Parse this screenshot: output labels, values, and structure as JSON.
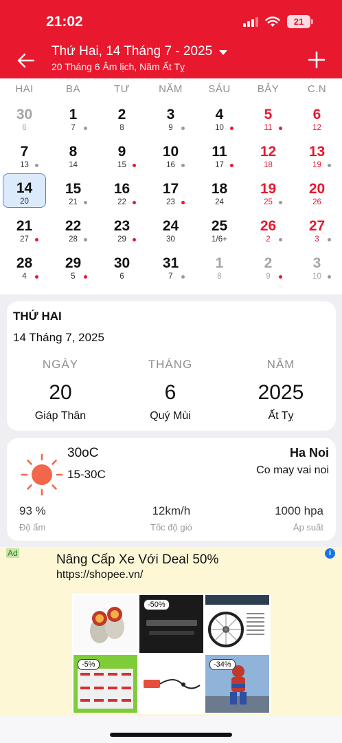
{
  "status_bar": {
    "time": "21:02",
    "battery": "21"
  },
  "header": {
    "title": "Thứ Hai, 14 Tháng 7 - 2025",
    "subtitle": "20 Tháng 6 Âm lịch, Năm Ất Tỵ"
  },
  "weekdays": [
    "HAI",
    "BA",
    "TƯ",
    "NĂM",
    "SÁU",
    "BẢY",
    "C.N"
  ],
  "calendar_days": [
    {
      "solar": "30",
      "lunar": "6",
      "color": "gray",
      "dot": ""
    },
    {
      "solar": "1",
      "lunar": "7",
      "color": "normal",
      "dot": "gray"
    },
    {
      "solar": "2",
      "lunar": "8",
      "color": "normal",
      "dot": ""
    },
    {
      "solar": "3",
      "lunar": "9",
      "color": "normal",
      "dot": "gray"
    },
    {
      "solar": "4",
      "lunar": "10",
      "color": "normal",
      "dot": "red"
    },
    {
      "solar": "5",
      "lunar": "11",
      "color": "red",
      "dot": "red"
    },
    {
      "solar": "6",
      "lunar": "12",
      "color": "red",
      "dot": ""
    },
    {
      "solar": "7",
      "lunar": "13",
      "color": "normal",
      "dot": "gray"
    },
    {
      "solar": "8",
      "lunar": "14",
      "color": "normal",
      "dot": ""
    },
    {
      "solar": "9",
      "lunar": "15",
      "color": "normal",
      "dot": "red"
    },
    {
      "solar": "10",
      "lunar": "16",
      "color": "normal",
      "dot": "gray"
    },
    {
      "solar": "11",
      "lunar": "17",
      "color": "normal",
      "dot": "red"
    },
    {
      "solar": "12",
      "lunar": "18",
      "color": "red",
      "dot": ""
    },
    {
      "solar": "13",
      "lunar": "19",
      "color": "red",
      "dot": "gray"
    },
    {
      "solar": "14",
      "lunar": "20",
      "color": "normal",
      "dot": "",
      "selected": true
    },
    {
      "solar": "15",
      "lunar": "21",
      "color": "normal",
      "dot": "gray"
    },
    {
      "solar": "16",
      "lunar": "22",
      "color": "normal",
      "dot": "red"
    },
    {
      "solar": "17",
      "lunar": "23",
      "color": "normal",
      "dot": "red"
    },
    {
      "solar": "18",
      "lunar": "24",
      "color": "normal",
      "dot": ""
    },
    {
      "solar": "19",
      "lunar": "25",
      "color": "red",
      "dot": "gray"
    },
    {
      "solar": "20",
      "lunar": "26",
      "color": "red",
      "dot": ""
    },
    {
      "solar": "21",
      "lunar": "27",
      "color": "normal",
      "dot": "red"
    },
    {
      "solar": "22",
      "lunar": "28",
      "color": "normal",
      "dot": "gray"
    },
    {
      "solar": "23",
      "lunar": "29",
      "color": "normal",
      "dot": "red"
    },
    {
      "solar": "24",
      "lunar": "30",
      "color": "normal",
      "dot": ""
    },
    {
      "solar": "25",
      "lunar": "1/6+",
      "color": "normal",
      "dot": ""
    },
    {
      "solar": "26",
      "lunar": "2",
      "color": "red",
      "dot": "gray"
    },
    {
      "solar": "27",
      "lunar": "3",
      "color": "red",
      "dot": "gray"
    },
    {
      "solar": "28",
      "lunar": "4",
      "color": "normal",
      "dot": "red"
    },
    {
      "solar": "29",
      "lunar": "5",
      "color": "normal",
      "dot": "red"
    },
    {
      "solar": "30",
      "lunar": "6",
      "color": "normal",
      "dot": ""
    },
    {
      "solar": "31",
      "lunar": "7",
      "color": "normal",
      "dot": "gray"
    },
    {
      "solar": "1",
      "lunar": "8",
      "color": "gray",
      "dot": ""
    },
    {
      "solar": "2",
      "lunar": "9",
      "color": "gray",
      "dot": "red"
    },
    {
      "solar": "3",
      "lunar": "10",
      "color": "gray",
      "dot": "gray"
    }
  ],
  "day_info": {
    "weekday": "THỨ HAI",
    "date": "14 Tháng 7, 2025",
    "day": {
      "label": "NGÀY",
      "value": "20",
      "can_chi": "Giáp Thân"
    },
    "month": {
      "label": "THÁNG",
      "value": "6",
      "can_chi": "Quý Mùi"
    },
    "year": {
      "label": "NĂM",
      "value": "2025",
      "can_chi": "Ất Tỵ"
    }
  },
  "weather": {
    "icon": "sun-icon",
    "temp": "30oC",
    "range": "15-30C",
    "city": "Ha Noi",
    "condition": "Co may vai noi",
    "humidity": {
      "value": "93 %",
      "label": "Độ ẩm"
    },
    "wind": {
      "value": "12km/h",
      "label": "Tốc độ gió"
    },
    "pressure": {
      "value": "1000 hpa",
      "label": "Áp suất"
    }
  },
  "ad": {
    "badge": "Ad",
    "headline": "Nâng Cấp Xe Với Deal 50%",
    "url": "https://shopee.vn/",
    "tiles": [
      {
        "badge": ""
      },
      {
        "badge": "-50%"
      },
      {
        "badge": ""
      },
      {
        "badge": "-5%"
      },
      {
        "badge": ""
      },
      {
        "badge": "-34%"
      }
    ]
  },
  "colors": {
    "accent": "#e8192f",
    "selected_bg": "#dcebfb",
    "selected_border": "#3b8ae6"
  }
}
